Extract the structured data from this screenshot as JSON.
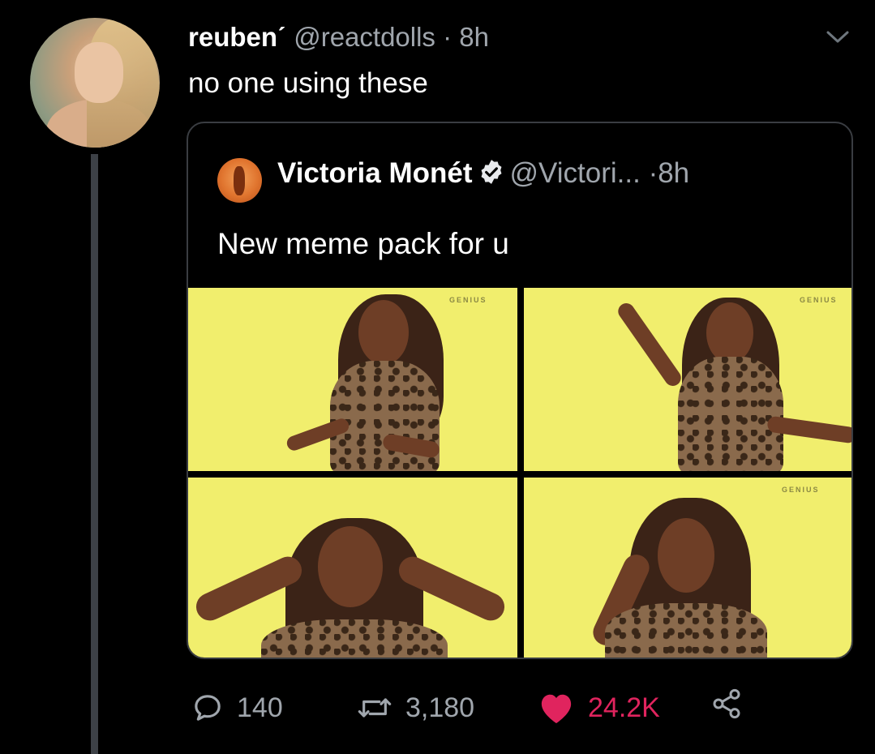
{
  "tweet": {
    "display_name": "reuben",
    "name_mark": "ˊ",
    "handle": "@reactdolls",
    "separator": "·",
    "time": "8h",
    "text": "no one using these",
    "menu_icon": "chevron-down-icon"
  },
  "quoted_tweet": {
    "display_name": "Victoria Monét",
    "verified_icon": "verified-badge-icon",
    "handle": "@Victori...",
    "separator": "·",
    "time": "8h",
    "text": "New meme pack for u",
    "media_watermark": "GENIUS"
  },
  "actions": {
    "reply_count": "140",
    "retweet_count": "3,180",
    "like_count": "24.2K",
    "liked": true
  },
  "colors": {
    "background": "#000000",
    "secondary_text": "#a0a6ad",
    "like_pink": "#e0245e",
    "media_yellow": "#f1ee6d",
    "border": "#3a3d42"
  }
}
